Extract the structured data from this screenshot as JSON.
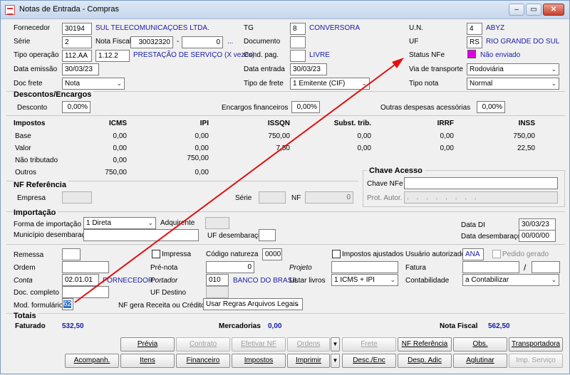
{
  "window": {
    "title": "Notas de Entrada - Compras",
    "min": "‒",
    "max": "▭",
    "close": "✕"
  },
  "header": {
    "fornecedor": {
      "label": "Fornecedor",
      "code": "30194",
      "name": "SUL TELECOMUNICAÇOES LTDA."
    },
    "serie": {
      "label": "Série",
      "value": "2"
    },
    "nota_fiscal": {
      "label": "Nota Fiscal",
      "value": "30032320",
      "dash": "-",
      "suffix": "0",
      "more": "..."
    },
    "tipo_operacao": {
      "label": "Tipo operação",
      "code": "112.AA",
      "cfop": "1.12.2",
      "desc": "PRESTAÇÃO DE SERVIÇO (X vezes)"
    },
    "data_emissao": {
      "label": "Data emissão",
      "value": "30/03/23"
    },
    "doc_frete": {
      "label": "Doc frete",
      "value": "Nota"
    },
    "tg": {
      "label": "TG",
      "code": "8",
      "name": "CONVERSORA"
    },
    "documento": {
      "label": "Documento",
      "value": ""
    },
    "cond_pag": {
      "label": "Cond. pag.",
      "code": "",
      "name": "LIVRE"
    },
    "data_entrada": {
      "label": "Data entrada",
      "value": "30/03/23"
    },
    "tipo_frete": {
      "label": "Tipo de frete",
      "value": "1 Emitente (CIF)"
    },
    "un": {
      "label": "U.N.",
      "code": "4",
      "name": "ABYZ"
    },
    "uf": {
      "label": "UF",
      "code": "RS",
      "name": "RIO GRANDE DO SUL"
    },
    "status_nfe": {
      "label": "Status NFe",
      "value": "Não enviado",
      "color": "#e000e0"
    },
    "via_transporte": {
      "label": "Via de transporte",
      "value": "Rodoviária"
    },
    "tipo_nota": {
      "label": "Tipo nota",
      "value": "Normal"
    }
  },
  "descontos": {
    "title": "Descontos/Encargos",
    "desconto": {
      "label": "Desconto",
      "value": "0,00%"
    },
    "encargos": {
      "label": "Encargos financeiros",
      "value": "0,00%"
    },
    "outras": {
      "label": "Outras despesas acessórias",
      "value": "0,00%"
    }
  },
  "impostos": {
    "title": "Impostos",
    "columns": [
      "ICMS",
      "IPI",
      "ISSQN",
      "Subst. trib.",
      "IRRF",
      "INSS"
    ],
    "rows": [
      {
        "label": "Base",
        "values": [
          "0,00",
          "0,00",
          "750,00",
          "0,00",
          "0,00",
          "750,00"
        ]
      },
      {
        "label": "Valor",
        "values": [
          "0,00",
          "0,00",
          "7,50",
          "0,00",
          "0,00",
          "22,50"
        ]
      },
      {
        "label": "Não tributado",
        "values": [
          "0,00",
          "750,00",
          "",
          "",
          "",
          ""
        ]
      },
      {
        "label": "Outros",
        "values": [
          "750,00",
          "0,00",
          "",
          "",
          "",
          ""
        ]
      }
    ]
  },
  "chave_acesso": {
    "title": "Chave Acesso",
    "chave_label": "Chave NFe",
    "chave_value": "",
    "prot_label": "Prot. Autor.",
    "prot_value": ". . . . . . . ."
  },
  "nf_referencia": {
    "title": "NF Referência",
    "empresa_label": "Empresa",
    "serie_label": "Série",
    "nf_label": "NF",
    "nf_value": "0"
  },
  "importacao": {
    "title": "Importação",
    "forma_label": "Forma de importação",
    "forma_value": "1 Direta",
    "adquirente_label": "Adquirente",
    "municipio_label": "Município desembaraço",
    "uf_label": "UF desembaraço",
    "data_di_label": "Data DI",
    "data_di_value": "30/03/23",
    "data_desemb_label": "Data desembaraço",
    "data_desemb_value": "00/00/00"
  },
  "misc": {
    "remessa_label": "Remessa",
    "impressa_label": "Impressa",
    "codigo_natureza_label": "Código natureza",
    "codigo_natureza_value": "0000",
    "impostos_ajustados_label": "Impostos ajustados",
    "usuario_label": "Usuário autorizado",
    "usuario_value": "ANA",
    "pedido_gerado_label": "Pedido gerado",
    "ordem_label": "Ordem",
    "pre_nota_label": "Pré-nota",
    "pre_nota_value": "0",
    "projeto_label": "Projeto",
    "fatura_label": "Fatura",
    "fatura_sep": "/",
    "conta_label": "Conta",
    "conta_value": "02.01.01",
    "conta_name": "FORNECEDOR",
    "portador_label": "Portador",
    "portador_value": "010",
    "portador_name": "BANCO DO BRASIL",
    "listar_livros_label": "Listar livros",
    "listar_livros_value": "1 ICMS + IPI",
    "contabilidade_label": "Contabilidade",
    "contabilidade_value": "a Contabilizar",
    "doc_completo_label": "Doc. completo",
    "uf_destino_label": "UF Destino",
    "mod_formulario_label": "Mod. formulário",
    "mod_formulario_value": "62",
    "nf_gera_label": "NF gera Receita ou Crédito",
    "nf_gera_value": "Usar Regras Arquivos Legais"
  },
  "totais": {
    "title": "Totais",
    "faturado_label": "Faturado",
    "faturado_value": "532,50",
    "mercadorias_label": "Mercadorias",
    "mercadorias_value": "0,00",
    "nota_fiscal_label": "Nota Fiscal",
    "nota_fiscal_value": "562,50"
  },
  "buttons_row1": [
    "Prévia",
    "Contrato",
    "Efetivar NF",
    "Ordens",
    "Frete",
    "NF Referência",
    "Obs.",
    "Transportadora"
  ],
  "buttons_row2": [
    "Acompanh.",
    "Itens",
    "Financeiro",
    "Impostos",
    "Imprimir",
    "Desc./Enc",
    "Desp. Adic",
    "Aglutinar",
    "Imp. Serviço"
  ],
  "colors": {
    "accent_blue": "#1a1aa8",
    "annotation_red": "#e01010"
  }
}
